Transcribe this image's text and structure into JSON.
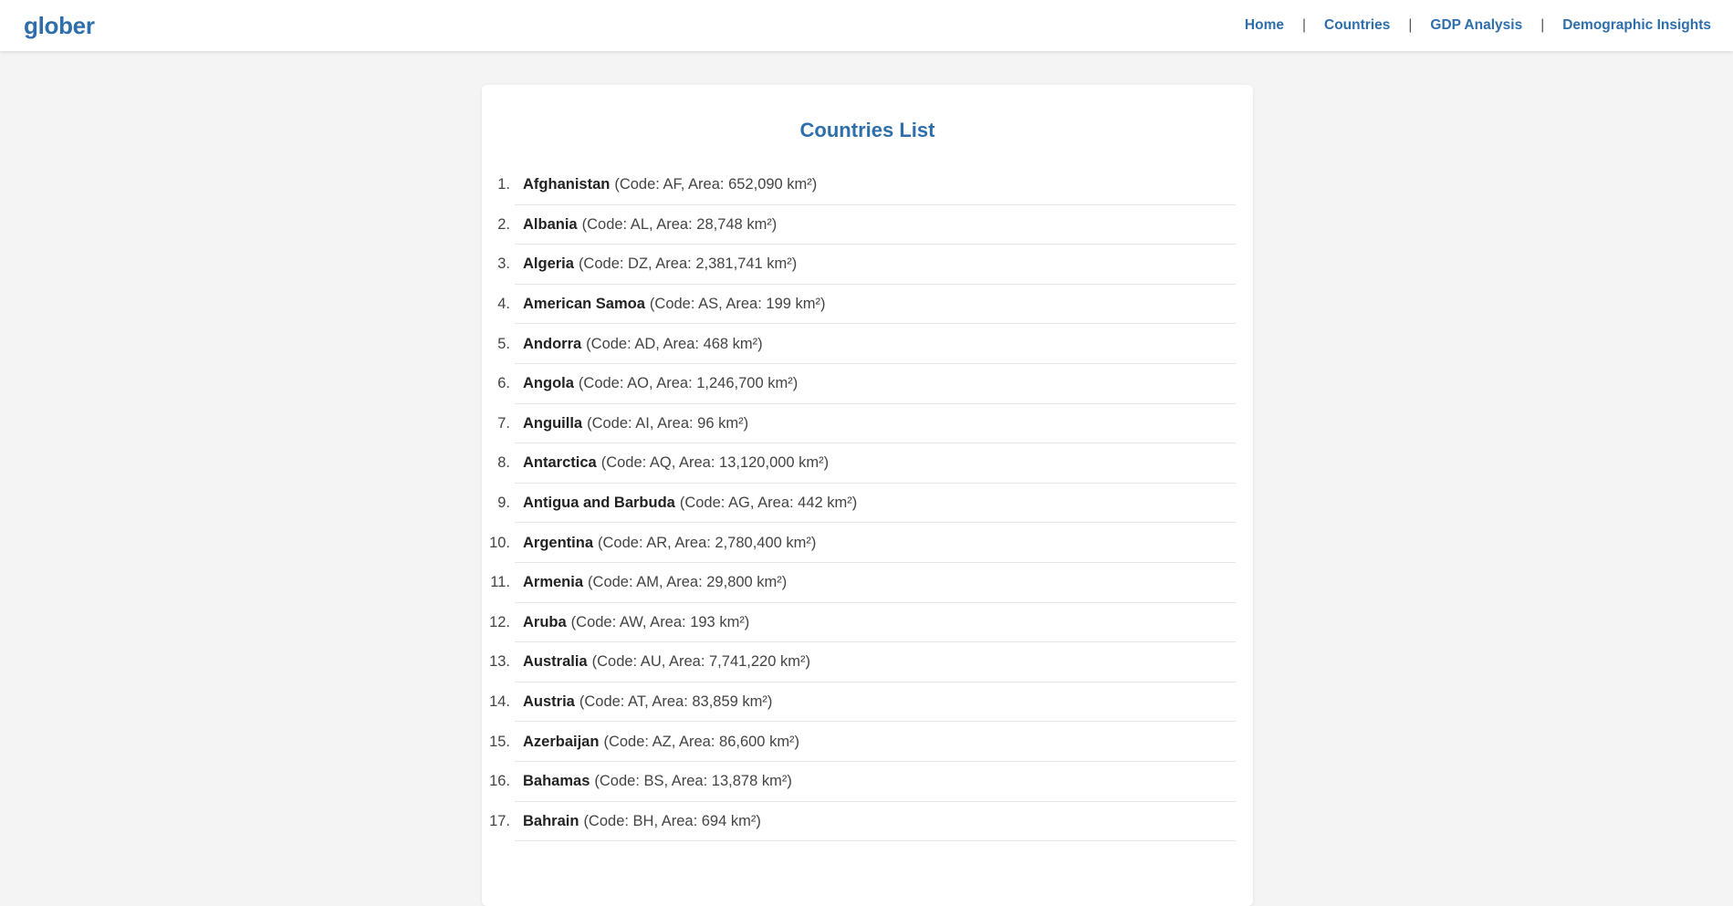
{
  "header": {
    "brand": "glober",
    "nav": [
      "Home",
      "Countries",
      "GDP Analysis",
      "Demographic Insights"
    ],
    "separator": "|"
  },
  "main": {
    "title": "Countries List",
    "countries": [
      {
        "num": "1.",
        "name": "Afghanistan",
        "detail": "(Code: AF, Area: 652,090 km²)"
      },
      {
        "num": "2.",
        "name": "Albania",
        "detail": "(Code: AL, Area: 28,748 km²)"
      },
      {
        "num": "3.",
        "name": "Algeria",
        "detail": "(Code: DZ, Area: 2,381,741 km²)"
      },
      {
        "num": "4.",
        "name": "American Samoa",
        "detail": "(Code: AS, Area: 199 km²)"
      },
      {
        "num": "5.",
        "name": "Andorra",
        "detail": "(Code: AD, Area: 468 km²)"
      },
      {
        "num": "6.",
        "name": "Angola",
        "detail": "(Code: AO, Area: 1,246,700 km²)"
      },
      {
        "num": "7.",
        "name": "Anguilla",
        "detail": "(Code: AI, Area: 96 km²)"
      },
      {
        "num": "8.",
        "name": "Antarctica",
        "detail": "(Code: AQ, Area: 13,120,000 km²)"
      },
      {
        "num": "9.",
        "name": "Antigua and Barbuda",
        "detail": "(Code: AG, Area: 442 km²)"
      },
      {
        "num": "10.",
        "name": "Argentina",
        "detail": "(Code: AR, Area: 2,780,400 km²)"
      },
      {
        "num": "11.",
        "name": "Armenia",
        "detail": "(Code: AM, Area: 29,800 km²)"
      },
      {
        "num": "12.",
        "name": "Aruba",
        "detail": "(Code: AW, Area: 193 km²)"
      },
      {
        "num": "13.",
        "name": "Australia",
        "detail": "(Code: AU, Area: 7,741,220 km²)"
      },
      {
        "num": "14.",
        "name": "Austria",
        "detail": "(Code: AT, Area: 83,859 km²)"
      },
      {
        "num": "15.",
        "name": "Azerbaijan",
        "detail": "(Code: AZ, Area: 86,600 km²)"
      },
      {
        "num": "16.",
        "name": "Bahamas",
        "detail": "(Code: BS, Area: 13,878 km²)"
      },
      {
        "num": "17.",
        "name": "Bahrain",
        "detail": "(Code: BH, Area: 694 km²)"
      }
    ]
  }
}
